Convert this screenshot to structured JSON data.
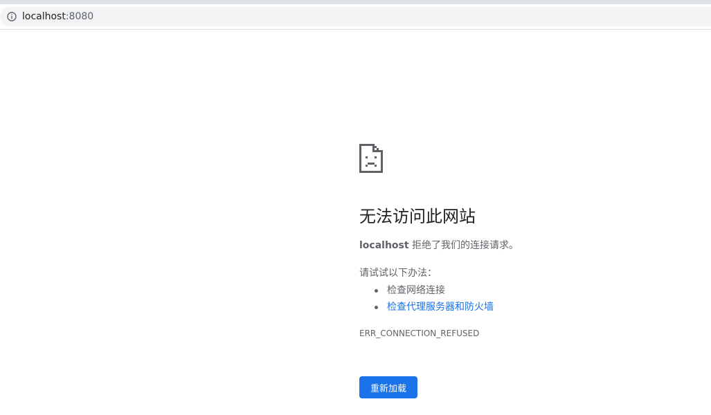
{
  "browser": {
    "url_host": "localhost",
    "url_port": ":8080",
    "address_icon": "info-icon"
  },
  "error_page": {
    "icon": "sad-page-icon",
    "heading": "无法访问此网站",
    "host": "localhost",
    "message": " 拒绝了我们的连接请求。",
    "suggestions_title": "请试试以下办法：",
    "suggestions": [
      "检查网络连接",
      "检查代理服务器和防火墙"
    ],
    "error_code": "ERR_CONNECTION_REFUSED",
    "reload_label": "重新加载"
  },
  "colors": {
    "link": "#1a73e8",
    "button": "#1a73e8",
    "text": "#5f6368",
    "heading": "#202124"
  }
}
